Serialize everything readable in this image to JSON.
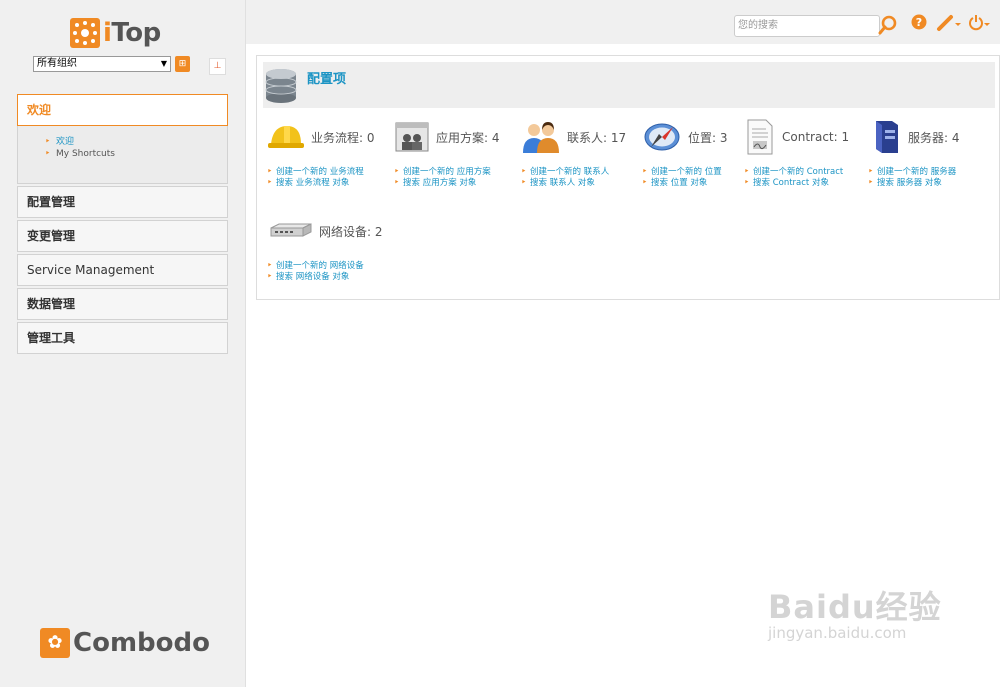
{
  "brand": {
    "logo_i": "i",
    "logo_rest": "Top",
    "footer": "Combodo"
  },
  "org_select": {
    "value": "所有组织"
  },
  "search": {
    "placeholder": "您的搜索"
  },
  "menu": {
    "welcome": "欢迎",
    "welcome_items": [
      "欢迎",
      "My Shortcuts"
    ],
    "sections": [
      "配置管理",
      "变更管理",
      "Service Management",
      "数据管理",
      "管理工具"
    ]
  },
  "panel": {
    "title": "配置项"
  },
  "classes": [
    {
      "label": "业务流程: 0",
      "icon": "hard-hat-icon",
      "create": "创建一个新的 业务流程",
      "search": "搜索 业务流程 对象"
    },
    {
      "label": "应用方案: 4",
      "icon": "application-solution-icon",
      "create": "创建一个新的 应用方案",
      "search": "搜索 应用方案 对象"
    },
    {
      "label": "联系人: 17",
      "icon": "contacts-icon",
      "create": "创建一个新的 联系人",
      "search": "搜索 联系人 对象"
    },
    {
      "label": "位置: 3",
      "icon": "compass-icon",
      "create": "创建一个新的 位置",
      "search": "搜索 位置 对象"
    },
    {
      "label": "Contract: 1",
      "icon": "contract-icon",
      "create": "创建一个新的 Contract",
      "search": "搜索 Contract 对象"
    },
    {
      "label": "服务器: 4",
      "icon": "server-icon",
      "create": "创建一个新的 服务器",
      "search": "搜索 服务器 对象"
    },
    {
      "label": "网络设备: 2",
      "icon": "network-device-icon",
      "create": "创建一个新的 网络设备",
      "search": "搜索 网络设备 对象"
    }
  ],
  "watermark": {
    "big": "Baidu经验",
    "small": "jingyan.baidu.com"
  },
  "colors": {
    "accent": "#f08a24",
    "link": "#1c94c4"
  }
}
